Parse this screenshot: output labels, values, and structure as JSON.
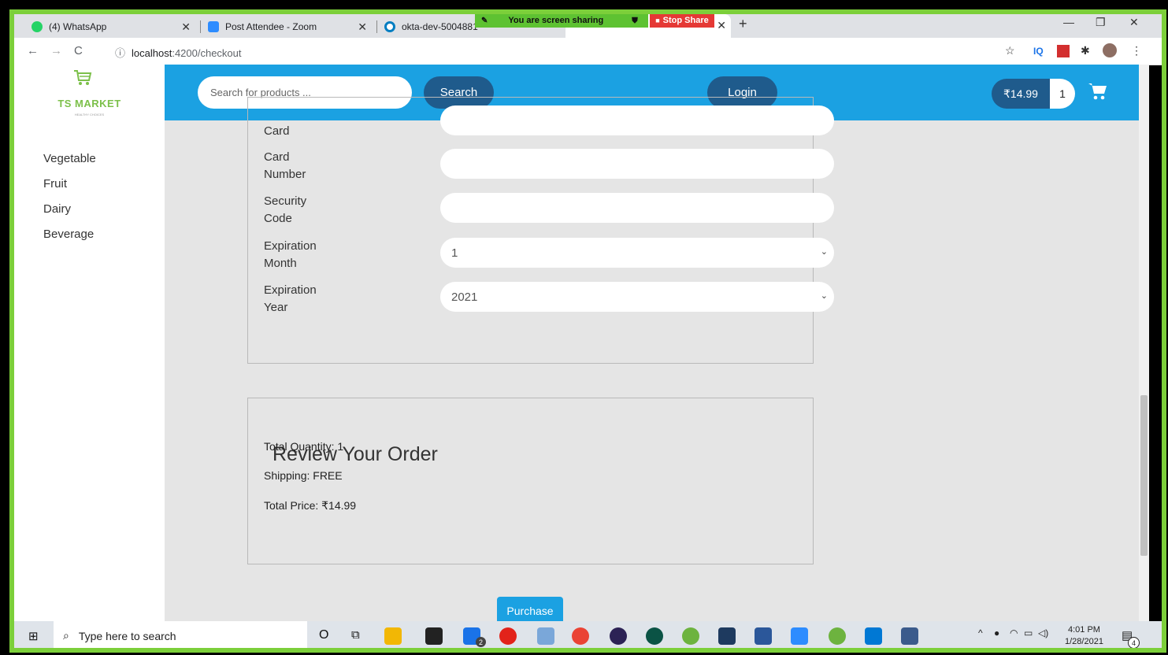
{
  "browser": {
    "tabs": [
      {
        "title": "(4) WhatsApp"
      },
      {
        "title": "Post Attendee - Zoom"
      },
      {
        "title": "okta-dev-5004881"
      }
    ],
    "share_banner": "You are screen sharing",
    "stop_share": "Stop Share",
    "url_host": "localhost",
    "url_path": ":4200/checkout"
  },
  "header": {
    "logo_name": "TS MARKET",
    "logo_tagline": "HEALTHY CHOICES",
    "search_placeholder": "Search for products ...",
    "search_button": "Search",
    "login_button": "Login",
    "cart_total": "₹14.99",
    "cart_quantity": "1"
  },
  "sidebar": {
    "items": [
      {
        "label": "Vegetable"
      },
      {
        "label": "Fruit"
      },
      {
        "label": "Dairy"
      },
      {
        "label": "Beverage"
      }
    ]
  },
  "payment": {
    "card_label_tail": "Card",
    "card_number_label_1": "Card",
    "card_number_label_2": "Number",
    "security_code_label_1": "Security",
    "security_code_label_2": "Code",
    "exp_month_label_1": "Expiration",
    "exp_month_label_2": "Month",
    "exp_month_value": "1",
    "exp_year_label_1": "Expiration",
    "exp_year_label_2": "Year",
    "exp_year_value": "2021"
  },
  "review": {
    "legend": "Review Your Order",
    "total_quantity": "Total Quantity: 1",
    "shipping": "Shipping: FREE",
    "total_price": "Total Price: ₹14.99"
  },
  "purchase_button": "Purchase",
  "taskbar": {
    "search_placeholder": "Type here to search",
    "time": "4:01 PM",
    "date": "1/28/2021",
    "notification_count": "4",
    "mail_badge": "2"
  }
}
